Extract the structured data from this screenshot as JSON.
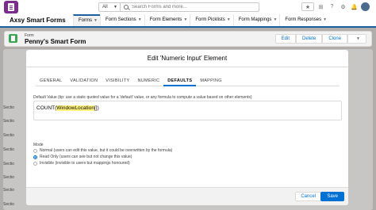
{
  "header": {
    "search_scope": "All",
    "search_placeholder": "Search Forms and more...",
    "icons": [
      "star-icon",
      "plus-icon",
      "help-icon",
      "settings-icon",
      "notifications-icon",
      "avatar"
    ]
  },
  "nav": {
    "app_name": "Axsy Smart Forms",
    "tabs": [
      {
        "label": "Forms",
        "active": true
      },
      {
        "label": "Form Sections",
        "active": false
      },
      {
        "label": "Form Elements",
        "active": false
      },
      {
        "label": "Form Picklists",
        "active": false
      },
      {
        "label": "Form Mappings",
        "active": false
      },
      {
        "label": "Form Responses",
        "active": false
      }
    ]
  },
  "record": {
    "type": "Form",
    "name": "Penny's Smart Form",
    "actions": [
      "Edit",
      "Delete",
      "Clone"
    ]
  },
  "background": {
    "section_labels": [
      "Sectio",
      "Sectio",
      "Sectio",
      "Sectio",
      "Sectio",
      "Sectio",
      "Sectio",
      "Sectio"
    ]
  },
  "modal": {
    "title": "Edit 'Numeric Input' Element",
    "tabs": [
      "GENERAL",
      "VALIDATION",
      "VISIBILITY",
      "NUMERIC",
      "DEFAULTS",
      "MAPPING"
    ],
    "active_tab": "DEFAULTS",
    "default_value_label": "Default Value (tip: use a static quoted value for a 'default' value, or any formula to compute a value based on other elements)",
    "formula": {
      "prefix": "COUNT(",
      "highlighted": "WindowLocation",
      "suffix": "[])"
    },
    "mode_label": "Mode",
    "mode_options": [
      {
        "label": "Normal (users can edit this value, but it could be overwritten by the formula)",
        "checked": false
      },
      {
        "label": "Read Only (users can see but not change this value)",
        "checked": true
      },
      {
        "label": "Invisible (invisible to users but mappings honoured)",
        "checked": false
      }
    ],
    "cancel_label": "Cancel",
    "save_label": "Save"
  },
  "colors": {
    "brand_blue": "#0070d2",
    "app_icon_purple": "#7b2c8c",
    "record_icon_green": "#3ba755",
    "highlight_yellow": "#fff27a"
  }
}
